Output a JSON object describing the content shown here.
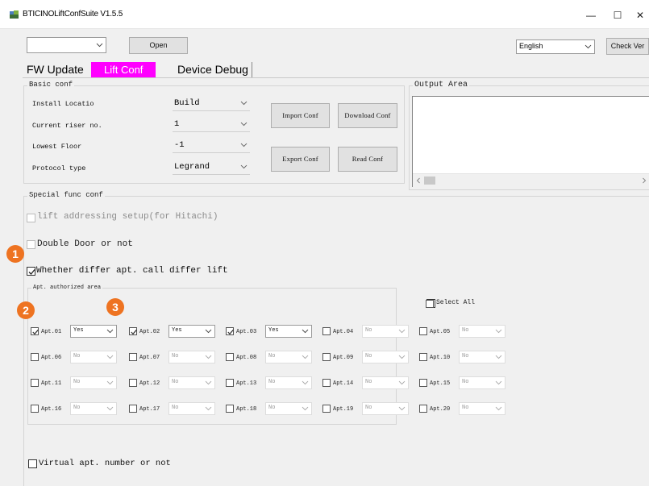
{
  "window": {
    "title": "BTICINOLiftConfSuite V1.5.5",
    "minimize_glyph": "—",
    "maximize_glyph": "☐",
    "close_glyph": "✕"
  },
  "toolbar": {
    "port_value": "",
    "open_label": "Open",
    "language_value": "English",
    "check_ver_label": "Check Ver"
  },
  "tabs": [
    {
      "label": "FW Update",
      "active": false
    },
    {
      "label": "Lift Conf",
      "active": true
    },
    {
      "label": "Device Debug",
      "active": false
    }
  ],
  "basic_conf": {
    "title": "Basic conf",
    "rows": [
      {
        "label": "Install Locatio",
        "value": "Build"
      },
      {
        "label": "Current riser no.",
        "value": "1"
      },
      {
        "label": "Lowest Floor",
        "value": "-1"
      },
      {
        "label": "Protocol type",
        "value": "Legrand"
      }
    ],
    "import_label": "Import Conf",
    "download_label": "Download Conf",
    "export_label": "Export Conf",
    "read_label": "Read Conf"
  },
  "output_area": {
    "title": "Output Area"
  },
  "special": {
    "title": "Special func conf",
    "lift_addressing_label": "lift addressing setup(for Hitachi)",
    "double_door_label": "Double Door or not",
    "differ_label": "Whether differ apt. call differ lift",
    "differ_checked": true,
    "authorized_title": "Apt. authorized area",
    "select_all_label": "Select All",
    "virtual_label": "Virtual apt. number or not"
  },
  "apartments": [
    {
      "label": "Apt.01",
      "checked": true,
      "value": "Yes"
    },
    {
      "label": "Apt.02",
      "checked": true,
      "value": "Yes"
    },
    {
      "label": "Apt.03",
      "checked": true,
      "value": "Yes"
    },
    {
      "label": "Apt.04",
      "checked": false,
      "value": "No"
    },
    {
      "label": "Apt.05",
      "checked": false,
      "value": "No"
    },
    {
      "label": "Apt.06",
      "checked": false,
      "value": "No"
    },
    {
      "label": "Apt.07",
      "checked": false,
      "value": "No"
    },
    {
      "label": "Apt.08",
      "checked": false,
      "value": "No"
    },
    {
      "label": "Apt.09",
      "checked": false,
      "value": "No"
    },
    {
      "label": "Apt.10",
      "checked": false,
      "value": "No"
    },
    {
      "label": "Apt.11",
      "checked": false,
      "value": "No"
    },
    {
      "label": "Apt.12",
      "checked": false,
      "value": "No"
    },
    {
      "label": "Apt.13",
      "checked": false,
      "value": "No"
    },
    {
      "label": "Apt.14",
      "checked": false,
      "value": "No"
    },
    {
      "label": "Apt.15",
      "checked": false,
      "value": "No"
    },
    {
      "label": "Apt.16",
      "checked": false,
      "value": "No"
    },
    {
      "label": "Apt.17",
      "checked": false,
      "value": "No"
    },
    {
      "label": "Apt.18",
      "checked": false,
      "value": "No"
    },
    {
      "label": "Apt.19",
      "checked": false,
      "value": "No"
    },
    {
      "label": "Apt.20",
      "checked": false,
      "value": "No"
    }
  ],
  "badges": [
    "1",
    "2",
    "3"
  ],
  "colors": {
    "active_tab": "#ff00ff",
    "badge": "#ee7321"
  }
}
